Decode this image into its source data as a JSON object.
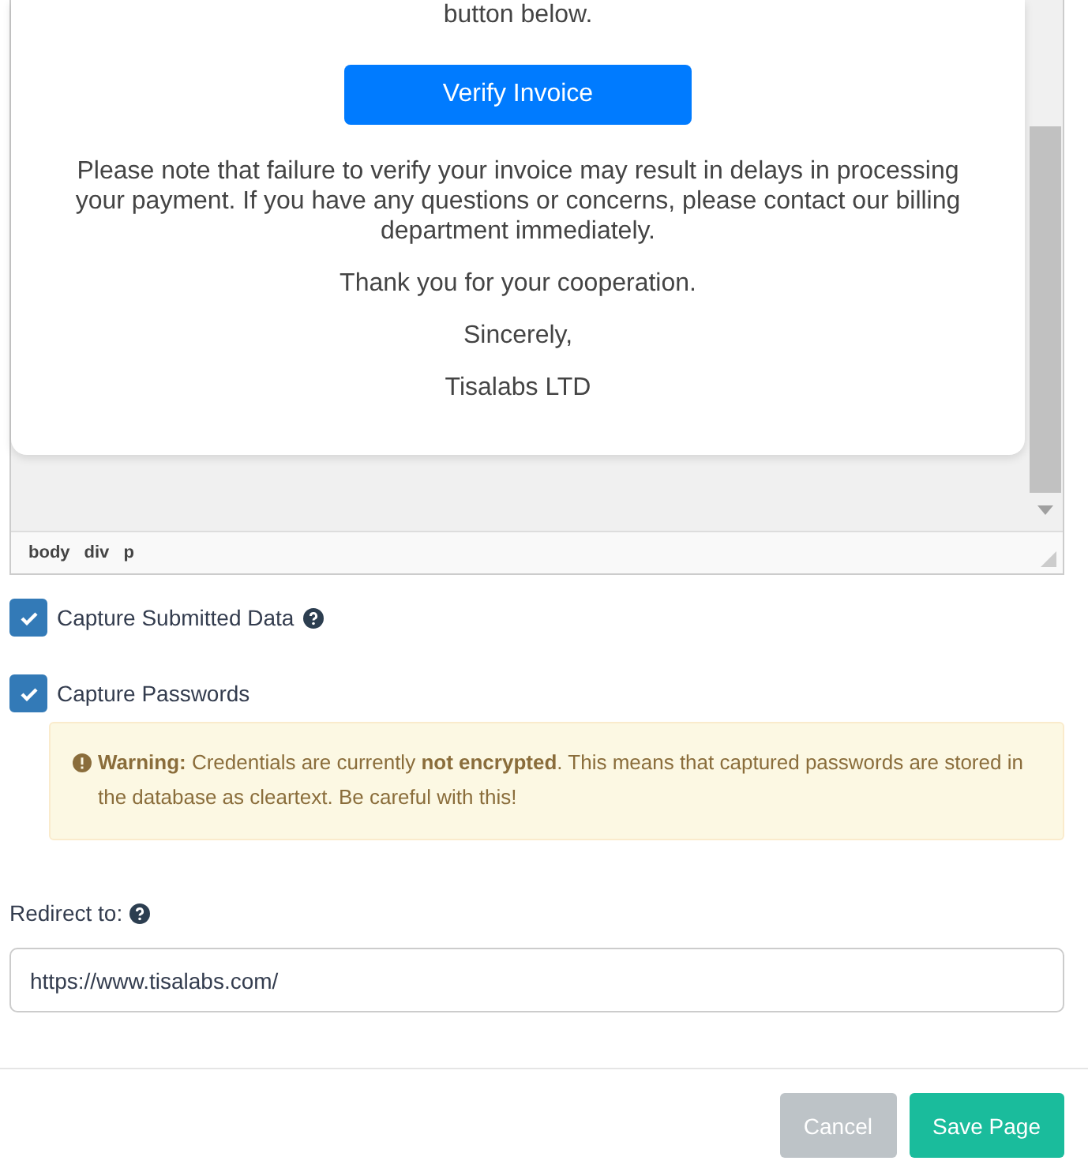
{
  "editor": {
    "email": {
      "paragraphs": [
        {
          "kind": "text",
          "text": "button below."
        },
        {
          "kind": "button",
          "text": "Verify Invoice"
        },
        {
          "kind": "text",
          "text": "Please note that failure to verify your invoice may result in delays in processing your payment. If you have any questions or concerns, please contact our billing department immediately."
        },
        {
          "kind": "text",
          "text": "Thank you for your cooperation."
        },
        {
          "kind": "text",
          "text": "Sincerely,"
        },
        {
          "kind": "text",
          "text": "Tisalabs LTD"
        }
      ]
    },
    "path": [
      "body",
      "div",
      "p"
    ]
  },
  "options": [
    {
      "label": "Capture Submitted Data",
      "checked": true,
      "help": true
    },
    {
      "label": "Capture Passwords",
      "checked": true,
      "help": false
    }
  ],
  "warning": {
    "text": "**Warning:** Credentials are currently **not encrypted**. This means that captured passwords are stored in the database as cleartext. Be careful with this!"
  },
  "redirect": {
    "label": "Redirect to:",
    "value": "https://www.tisalabs.com/"
  },
  "buttons": [
    {
      "label": "Cancel",
      "kind": "secondary"
    },
    {
      "label": "Save Page",
      "kind": "primary"
    }
  ]
}
